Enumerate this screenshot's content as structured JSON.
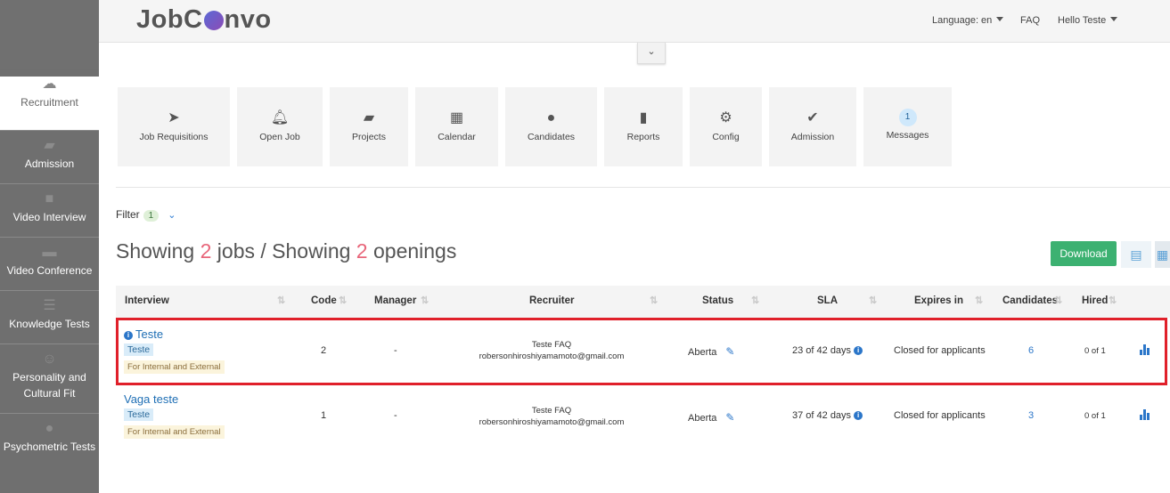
{
  "sidebar": {
    "items": [
      {
        "label": "Recruitment",
        "icon": "cloud-icon"
      },
      {
        "label": "Admission",
        "icon": "folder-icon"
      },
      {
        "label": "Video Interview",
        "icon": "video-camera-icon"
      },
      {
        "label": "Video Conference",
        "icon": "chat-icon"
      },
      {
        "label": "Knowledge Tests",
        "icon": "list-icon"
      },
      {
        "label": "Personality and Cultural Fit",
        "icon": "smiley-icon"
      },
      {
        "label": "Psychometric Tests",
        "icon": "user-icon"
      }
    ]
  },
  "header": {
    "logo": "JobConvo",
    "language": "Language: en",
    "faq": "FAQ",
    "greeting": "Hello Teste"
  },
  "tiles": [
    {
      "label": "Job Requisitions",
      "icon": "paper-plane-icon"
    },
    {
      "label": "Open Job",
      "icon": "bell-icon"
    },
    {
      "label": "Projects",
      "icon": "folder-open-icon"
    },
    {
      "label": "Calendar",
      "icon": "calendar-icon"
    },
    {
      "label": "Candidates",
      "icon": "user-icon"
    },
    {
      "label": "Reports",
      "icon": "bar-chart-icon"
    },
    {
      "label": "Config",
      "icon": "gear-icon"
    },
    {
      "label": "Admission",
      "icon": "check-icon"
    },
    {
      "label": "Messages",
      "badge": "1"
    }
  ],
  "filter": {
    "label": "Filter",
    "count": "1"
  },
  "summary": {
    "prefix": "Showing ",
    "jobs_count": "2",
    "jobs_text": " jobs / Showing ",
    "openings_count": "2",
    "openings_text": " openings"
  },
  "download_label": "Download",
  "table": {
    "headers": {
      "interview": "Interview",
      "code": "Code",
      "manager": "Manager",
      "recruiter": "Recruiter",
      "status": "Status",
      "sla": "SLA",
      "expires": "Expires in",
      "candidates": "Candidates",
      "hired": "Hired"
    },
    "rows": [
      {
        "title": "Teste",
        "tag": "Teste",
        "audience": "For Internal and External",
        "code": "2",
        "manager": "-",
        "recruiter_name": "Teste FAQ",
        "recruiter_email": "robersonhiroshiyamamoto@gmail.com",
        "status": "Aberta",
        "sla": "23 of 42 days",
        "expires": "Closed for applicants",
        "candidates": "6",
        "hired": "0 of 1"
      },
      {
        "title": "Vaga teste",
        "tag": "Teste",
        "audience": "For Internal and External",
        "code": "1",
        "manager": "-",
        "recruiter_name": "Teste FAQ",
        "recruiter_email": "robersonhiroshiyamamoto@gmail.com",
        "status": "Aberta",
        "sla": "37 of 42 days",
        "expires": "Closed for applicants",
        "candidates": "3",
        "hired": "0 of 1"
      }
    ]
  },
  "colors": {
    "accent": "#2b76c9",
    "download": "#3cb171",
    "highlight": "#e0202a",
    "count": "#e8667a"
  }
}
